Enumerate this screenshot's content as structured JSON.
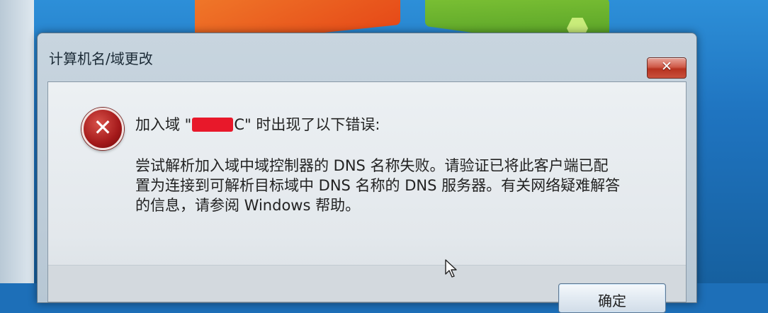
{
  "window": {
    "title": "计算机名/域更改",
    "close_label": "✕"
  },
  "dialog": {
    "icon": "error-icon",
    "line1_prefix": "加入域 \"",
    "line1_suffix": "C\" 时出现了以下错误:",
    "message_lines": [
      "尝试解析加入域中域控制器的 DNS 名称失败。请验证已将此客户端已配",
      "置为连接到可解析目标域中 DNS 名称的 DNS 服务器。有关网络疑难解答",
      "的信息，请参阅 Windows 帮助。"
    ],
    "ok_label": "确定"
  },
  "colors": {
    "error_red": "#a4191a",
    "redaction": "#e8182a"
  }
}
